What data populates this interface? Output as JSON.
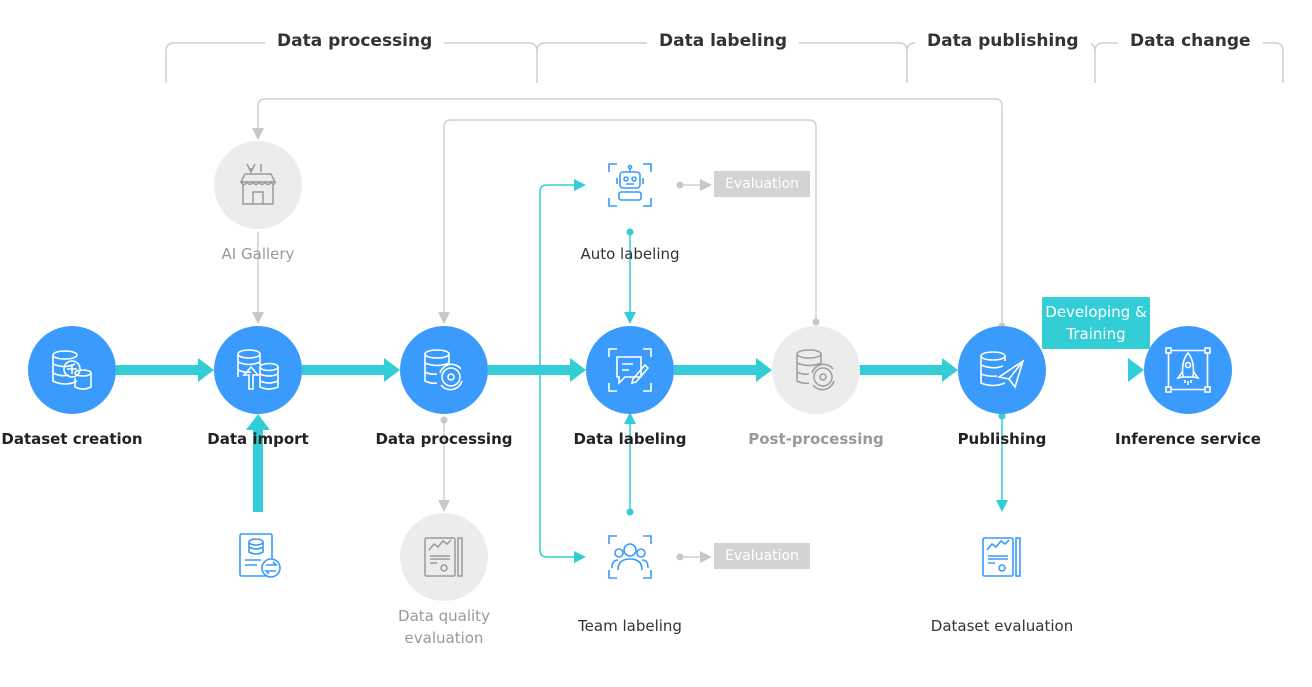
{
  "colors": {
    "node": "#3a9bfc",
    "flow": "#33cdd6",
    "inactive": "#cccccc"
  },
  "phases": [
    "Data processing",
    "Data labeling",
    "Data publishing",
    "Data change"
  ],
  "nodes": {
    "dataset_creation": "Dataset creation",
    "data_import": "Data import",
    "data_processing": "Data processing",
    "data_labeling": "Data labeling",
    "post_processing": "Post-processing",
    "publishing": "Publishing",
    "inference_service": "Inference service"
  },
  "side": {
    "ai_gallery": "AI Gallery",
    "auto_labeling": "Auto labeling",
    "team_labeling": "Team labeling",
    "data_quality_1": "Data quality",
    "data_quality_2": "evaluation",
    "dataset_evaluation": "Dataset evaluation",
    "evaluation": "Evaluation"
  },
  "developing_1": "Developing &",
  "developing_2": "Training"
}
